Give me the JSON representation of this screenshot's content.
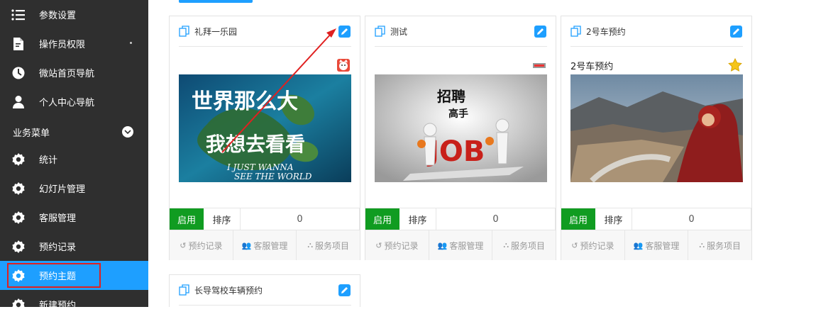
{
  "sidebar": {
    "items": [
      {
        "label": "参数设置",
        "icon": "list-icon"
      },
      {
        "label": "操作员权限",
        "icon": "document-edit-icon"
      },
      {
        "label": "微站首页导航",
        "icon": "clock-icon"
      },
      {
        "label": "个人中心导航",
        "icon": "user-icon"
      }
    ],
    "section_label": "业务菜单",
    "menu": [
      {
        "label": "统计",
        "icon": "gear-icon"
      },
      {
        "label": "幻灯片管理",
        "icon": "gear-icon"
      },
      {
        "label": "客服管理",
        "icon": "gear-icon"
      },
      {
        "label": "预约记录",
        "icon": "gear-icon"
      },
      {
        "label": "预约主题",
        "icon": "gear-icon"
      },
      {
        "label": "新建预约",
        "icon": "gear-icon"
      }
    ],
    "active_index": 4
  },
  "cards": [
    {
      "title": "礼拜一乐园",
      "name": "",
      "badge_icon": "cat-badge-icon",
      "image_caption_line1": "世界那么大",
      "image_caption_line2": "我想去看看",
      "image_caption_en1": "I JUST WANNA",
      "image_caption_en2": "SEE THE WORLD",
      "status_label": "启用",
      "sort_label": "排序",
      "sort_value": "0",
      "actions": [
        "预约记录",
        "客服管理",
        "服务项目"
      ]
    },
    {
      "title": "测试",
      "name": "",
      "badge_icon": "small-tag-icon",
      "image_caption_line1": "招聘",
      "image_caption_line2": "高手",
      "image_caption_en1": "JOB",
      "status_label": "启用",
      "sort_label": "排序",
      "sort_value": "0",
      "actions": [
        "预约记录",
        "客服管理",
        "服务项目"
      ]
    },
    {
      "title": "2号车预约",
      "name": "2号车预约",
      "badge_icon": "star-icon",
      "status_label": "启用",
      "sort_label": "排序",
      "sort_value": "0",
      "actions": [
        "预约记录",
        "客服管理",
        "服务项目"
      ]
    },
    {
      "title": "长导驾校车辆预约"
    }
  ],
  "colors": {
    "sidebar_bg": "#2f2f2f",
    "active_bg": "#1e9fff",
    "highlight_border": "#e02020",
    "enabled_green": "#109c21",
    "edit_blue": "#1e9fff",
    "annotation_arrow": "#e02020"
  }
}
